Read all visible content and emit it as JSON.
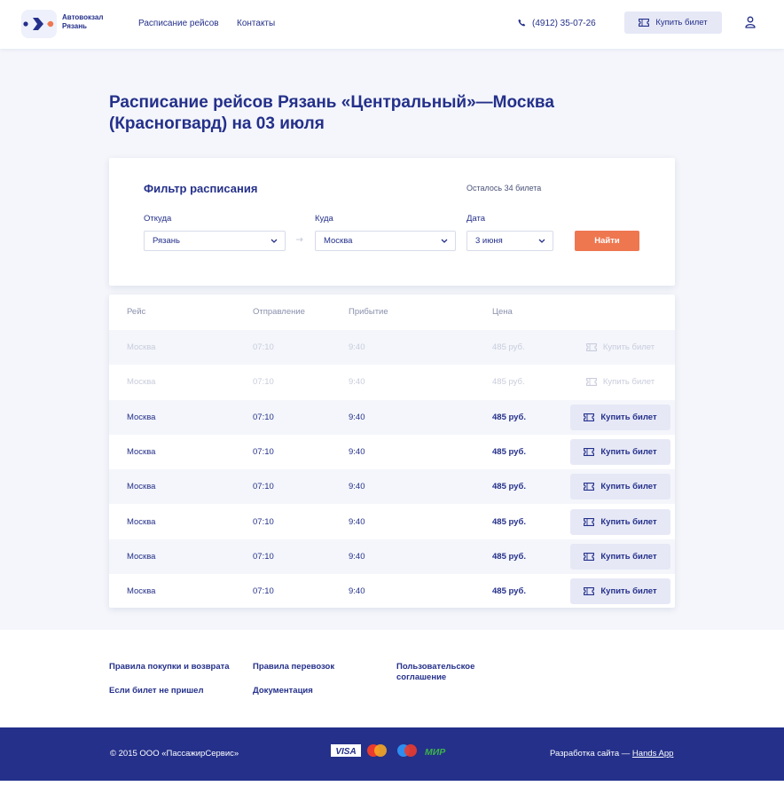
{
  "header": {
    "logo_line1": "Автовокзал",
    "logo_line2": "Рязань",
    "nav": [
      "Расписание рейсов",
      "Контакты"
    ],
    "phone": "(4912) 35-07-26",
    "buy_label": "Купить билет"
  },
  "page_title": "Расписание рейсов Рязань «Центральный»—Москва (Красногвард) на 03 июля",
  "filter": {
    "title": "Фильтр расписания",
    "tickets_left": "Осталось 34 билета",
    "from_label": "Откуда",
    "from_value": "Рязань",
    "to_label": "Куда",
    "to_value": "Москва",
    "date_label": "Дата",
    "date_value": "3 июня",
    "search_label": "Найти"
  },
  "table": {
    "columns": [
      "Рейс",
      "Отправление",
      "Прибытие",
      "Цена"
    ],
    "buy_label": "Купить билет",
    "rows": [
      {
        "route": "Москва",
        "departure": "07:10",
        "arrival": "9:40",
        "price": "485 руб.",
        "available": false
      },
      {
        "route": "Москва",
        "departure": "07:10",
        "arrival": "9:40",
        "price": "485 руб.",
        "available": false
      },
      {
        "route": "Москва",
        "departure": "07:10",
        "arrival": "9:40",
        "price": "485 руб.",
        "available": true
      },
      {
        "route": "Москва",
        "departure": "07:10",
        "arrival": "9:40",
        "price": "485 руб.",
        "available": true
      },
      {
        "route": "Москва",
        "departure": "07:10",
        "arrival": "9:40",
        "price": "485 руб.",
        "available": true
      },
      {
        "route": "Москва",
        "departure": "07:10",
        "arrival": "9:40",
        "price": "485 руб.",
        "available": true
      },
      {
        "route": "Москва",
        "departure": "07:10",
        "arrival": "9:40",
        "price": "485 руб.",
        "available": true
      },
      {
        "route": "Москва",
        "departure": "07:10",
        "arrival": "9:40",
        "price": "485 руб.",
        "available": true
      }
    ]
  },
  "footer": {
    "links": [
      "Правила покупки и возврата",
      "Если билет не пришел",
      "Правила перевозок",
      "Документация",
      "Пользовательское соглашение"
    ],
    "copyright": "© 2015 ООО «ПассажирСервис»",
    "payments": [
      "VISA",
      "Mastercard",
      "Maestro",
      "МИР"
    ],
    "credit_prefix": "Разработка сайта — ",
    "credit_link": "Hands App"
  },
  "colors": {
    "brand": "#24308a",
    "accent": "#ee7750",
    "background": "#f4f6fb",
    "button_bg": "#e6e8f6"
  }
}
